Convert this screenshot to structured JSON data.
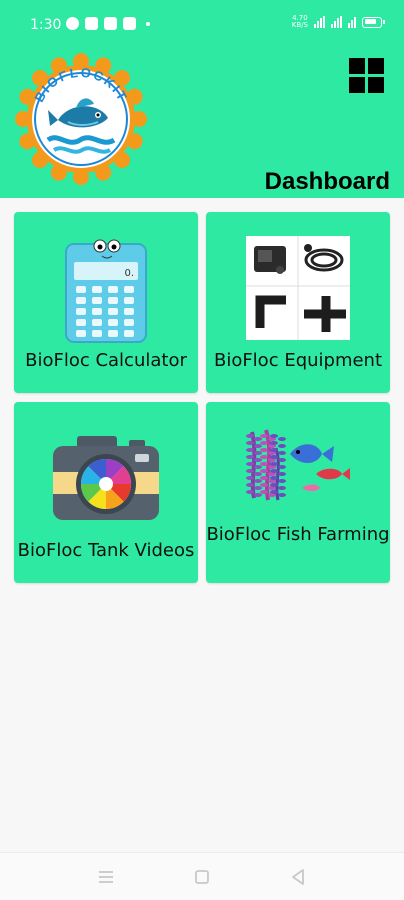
{
  "status_bar": {
    "time": "1:30",
    "net_speed_top": "4.70",
    "net_speed_bottom": "KB/S",
    "battery_level": 0.7
  },
  "header": {
    "title": "Dashboard",
    "logo_text": "BIOFLOCKIT",
    "menu_icon": "grid-menu-icon"
  },
  "cards": [
    {
      "label": "BioFloc Calculator",
      "icon": "calculator-icon",
      "display": "0."
    },
    {
      "label": "BioFloc Equipment",
      "icon": "equipment-icon"
    },
    {
      "label": "BioFloc Tank Videos",
      "icon": "camera-icon"
    },
    {
      "label": "BioFloc Fish Farming",
      "icon": "aquarium-fish-icon"
    }
  ],
  "colors": {
    "accent": "#2ee9a2",
    "background": "#f7f7f7"
  },
  "navbar": {
    "recent": "recent-apps-icon",
    "home": "home-icon",
    "back": "back-icon"
  }
}
